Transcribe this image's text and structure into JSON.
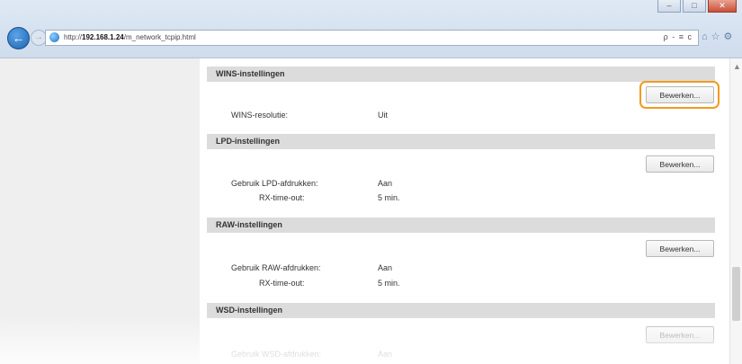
{
  "browser": {
    "url_prefix": "http://",
    "url_host": "192.168.1.24",
    "url_path": "/m_network_tcpip.html",
    "tools": "ρ - ≡ c",
    "icons": [
      "home-icon",
      "star-icon",
      "gear-icon"
    ]
  },
  "sections": {
    "wins": {
      "title": "WINS-instellingen",
      "edit_label": "Bewerken...",
      "rows": [
        {
          "label": "WINS-resolutie:",
          "value": "Uit"
        }
      ]
    },
    "lpd": {
      "title": "LPD-instellingen",
      "edit_label": "Bewerken...",
      "rows": [
        {
          "label": "Gebruik LPD-afdrukken:",
          "value": "Aan"
        },
        {
          "label": "RX-time-out:",
          "value": "5 min."
        }
      ]
    },
    "raw": {
      "title": "RAW-instellingen",
      "edit_label": "Bewerken...",
      "rows": [
        {
          "label": "Gebruik RAW-afdrukken:",
          "value": "Aan"
        },
        {
          "label": "RX-time-out:",
          "value": "5 min."
        }
      ]
    },
    "wsd": {
      "title": "WSD-instellingen",
      "edit_label": "Bewerken...",
      "rows": [
        {
          "label": "Gebruik WSD-afdrukken:",
          "value": "Aan"
        }
      ]
    }
  }
}
